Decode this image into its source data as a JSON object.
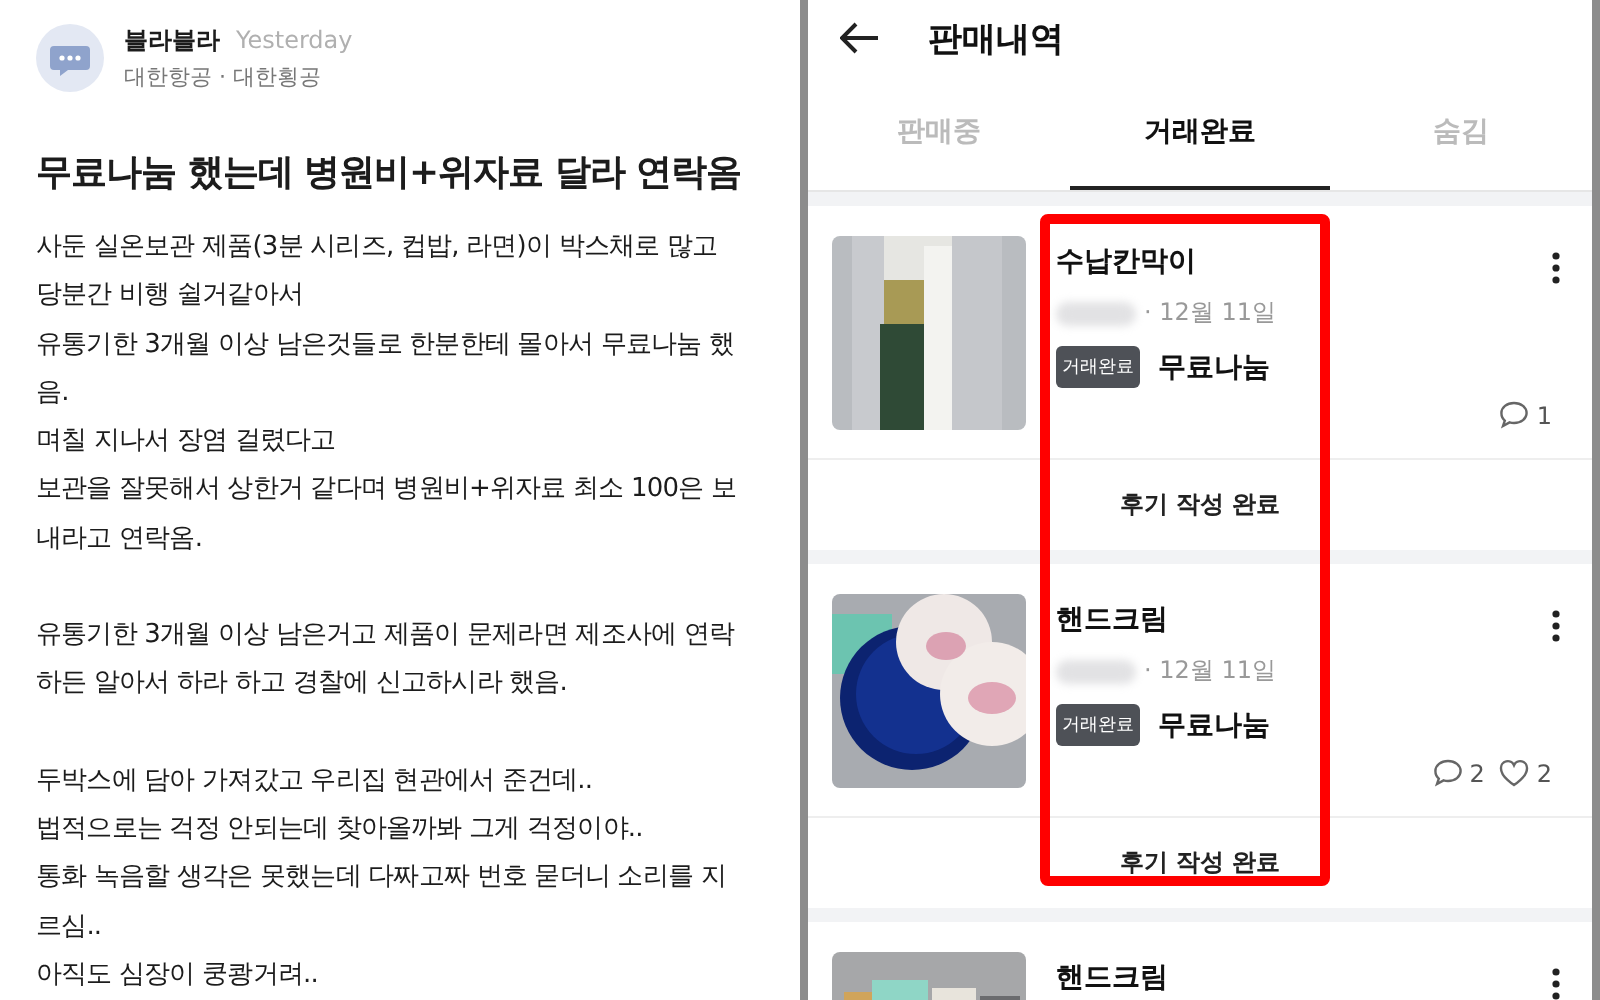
{
  "post": {
    "author": "블라블라",
    "time": "Yesterday",
    "company": "대한항공 · 대한횡공",
    "title": "무료나눔 했는데 병원비+위자료 달라 연락옴",
    "paragraphs": [
      [
        "사둔 실온보관 제품(3분 시리즈, 컵밥, 라면)이 박스채로 많고",
        "당분간 비행 쉴거같아서",
        "유통기한 3개월 이상 남은것들로 한분한테 몰아서 무료나눔 했",
        "음.",
        "며칠 지나서 장염 걸렸다고",
        "보관을 잘못해서 상한거 같다며 병원비+위자료 최소 100은 보",
        "내라고 연락옴."
      ],
      [
        "유통기한 3개월 이상 남은거고 제품이 문제라면 제조사에 연락",
        "하든 알아서 하라 하고 경찰에 신고하시라 했음."
      ],
      [
        "두박스에 담아 가져갔고 우리집 현관에서 준건데..",
        "법적으로는 걱정 안되는데 찾아올까봐 그게 걱정이야..",
        "통화 녹음할 생각은 못했는데 다짜고짜 번호 묻더니 소리를 지",
        "르심..",
        "아직도 심장이 쿵쾅거려.."
      ]
    ]
  },
  "sales": {
    "title": "판매내역",
    "tabs": [
      {
        "label": "판매중",
        "selected": false
      },
      {
        "label": "거래완료",
        "selected": true
      },
      {
        "label": "숨김",
        "selected": false
      }
    ],
    "items": [
      {
        "title": "수납칸막이",
        "date": "· 12월 11일",
        "badge": "거래완료",
        "price": "무료나눔",
        "stats": [
          {
            "kind": "comments",
            "count": "1"
          }
        ],
        "review": "후기 작성 완료"
      },
      {
        "title": "핸드크림",
        "date": "· 12월 11일",
        "badge": "거래완료",
        "price": "무료나눔",
        "stats": [
          {
            "kind": "comments",
            "count": "2"
          },
          {
            "kind": "likes",
            "count": "2"
          }
        ],
        "review": "후기 작성 완료"
      },
      {
        "title": "핸드크림"
      }
    ],
    "annotation": {
      "kind": "highlight-box"
    }
  }
}
